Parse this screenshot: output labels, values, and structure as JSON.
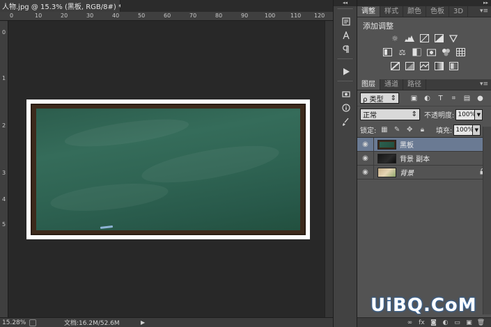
{
  "document": {
    "tab_title": "人物.jpg @ 15.3% (黑板, RGB/8#) *",
    "close_glyph": "×",
    "ruler_h_ticks": [
      "0",
      "10",
      "20",
      "30",
      "40",
      "50",
      "60",
      "70",
      "80",
      "90",
      "100",
      "110",
      "120"
    ],
    "ruler_v_ticks": [
      "0",
      "1",
      "2",
      "3",
      "4",
      "5"
    ]
  },
  "status_bar": {
    "zoom": "15.28%",
    "doc_size": "文档:16.2M/52.6M",
    "arrow": "▶"
  },
  "strip": {
    "collapse_glyph": "◂◂",
    "icons": [
      "history-icon",
      "character-icon",
      "paragraph-icon",
      "actions-icon",
      "tool-presets-icon",
      "info-icon",
      "brush-icon"
    ]
  },
  "adjustments_panel": {
    "collapse_glyph": "▸▸",
    "tabs": [
      "调整",
      "样式",
      "颜色",
      "色板",
      "3D"
    ],
    "active_tab": "调整",
    "menu_glyph": "▾≡",
    "title": "添加调整"
  },
  "layers_panel": {
    "tabs": [
      "图层",
      "通道",
      "路径"
    ],
    "active_tab": "图层",
    "menu_glyph": "▾≡",
    "filter_value": "ρ 类型",
    "blend_mode": "正常",
    "opacity_label": "不透明度:",
    "opacity_value": "100%",
    "lock_label": "锁定:",
    "fill_label": "填充:",
    "fill_value": "100%",
    "layers": [
      {
        "name": "黑板",
        "visible": true,
        "selected": true,
        "locked": false
      },
      {
        "name": "背景 副本",
        "visible": true,
        "selected": false,
        "locked": false
      },
      {
        "name": "背景",
        "visible": true,
        "selected": false,
        "locked": true
      }
    ]
  },
  "watermark": "UiBQ.CoM"
}
